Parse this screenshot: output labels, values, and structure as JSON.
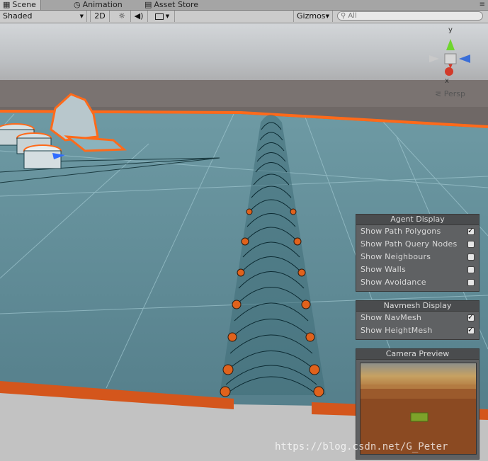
{
  "tabs": [
    {
      "label": "Scene",
      "icon": "grid-icon",
      "active": true
    },
    {
      "label": "Animation",
      "icon": "clock-icon",
      "active": false
    },
    {
      "label": "Asset Store",
      "icon": "store-icon",
      "active": false
    }
  ],
  "toolbar": {
    "shading_mode": "Shaded",
    "mode_2d": "2D",
    "gizmos_label": "Gizmos",
    "search_placeholder": "All"
  },
  "gizmo": {
    "y_label": "y",
    "x_label": "x",
    "projection_label": "Persp"
  },
  "agent_display": {
    "title": "Agent Display",
    "items": [
      {
        "label": "Show Path Polygons",
        "checked": true
      },
      {
        "label": "Show Path Query Nodes",
        "checked": false
      },
      {
        "label": "Show Neighbours",
        "checked": false
      },
      {
        "label": "Show Walls",
        "checked": false
      },
      {
        "label": "Show Avoidance",
        "checked": false
      }
    ]
  },
  "navmesh_display": {
    "title": "Navmesh Display",
    "items": [
      {
        "label": "Show NavMesh",
        "checked": true
      },
      {
        "label": "Show HeightMesh",
        "checked": true
      }
    ]
  },
  "camera_preview": {
    "title": "Camera Preview"
  },
  "watermark": "https://blog.csdn.net/G_Peter",
  "colors": {
    "navmesh": "#5e8a96",
    "selection_outline": "#ff6a1a",
    "sky": "#c9ccd0"
  }
}
